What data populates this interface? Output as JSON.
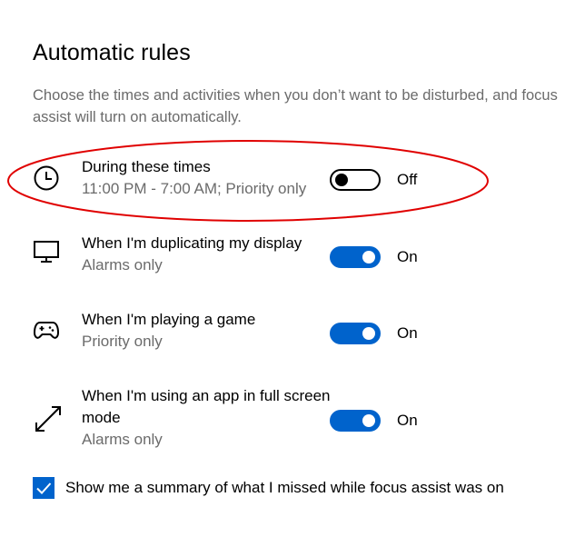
{
  "section": {
    "title": "Automatic rules",
    "description": "Choose the times and activities when you don’t want to be disturbed, and focus assist will turn on automatically."
  },
  "rules": [
    {
      "icon": "clock-icon",
      "name": "During these times",
      "subtitle": "11:00 PM - 7:00 AM; Priority only",
      "state": "off",
      "state_label": "Off",
      "highlighted": true
    },
    {
      "icon": "monitor-icon",
      "name": "When I'm duplicating my display",
      "subtitle": "Alarms only",
      "state": "on",
      "state_label": "On"
    },
    {
      "icon": "gamepad-icon",
      "name": "When I'm playing a game",
      "subtitle": "Priority only",
      "state": "on",
      "state_label": "On"
    },
    {
      "icon": "fullscreen-arrows-icon",
      "name": "When I'm using an app in full screen mode",
      "subtitle": "Alarms only",
      "state": "on",
      "state_label": "On"
    }
  ],
  "summary_checkbox": {
    "checked": true,
    "label": "Show me a summary of what I missed while focus assist was on"
  },
  "colors": {
    "accent": "#0063cc",
    "annotation": "#e00000",
    "secondary_text": "#6b6b6b"
  }
}
